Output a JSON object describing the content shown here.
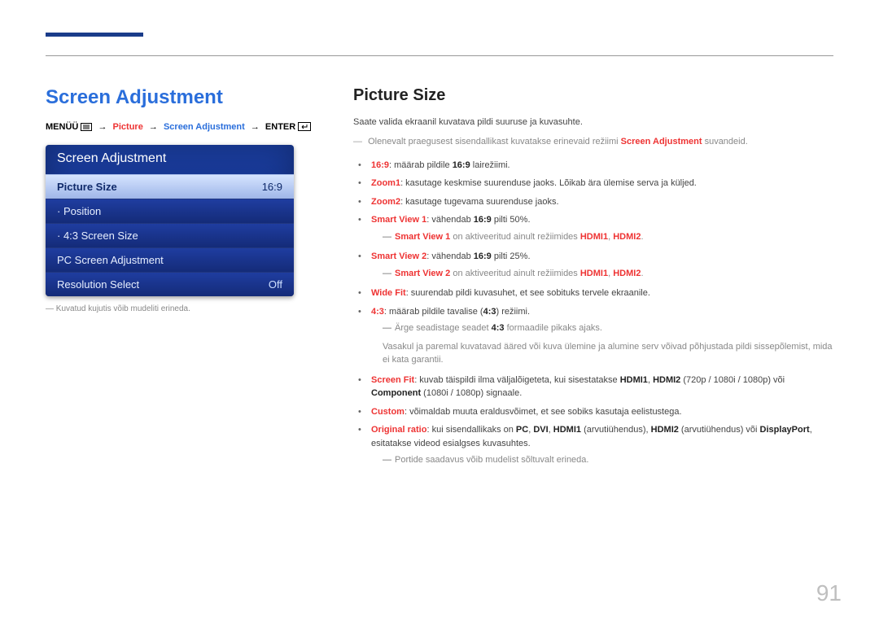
{
  "page_number": "91",
  "left": {
    "heading": "Screen Adjustment",
    "breadcrumb": {
      "menu": "MENÜÜ",
      "picture": "Picture",
      "screen_adj": "Screen Adjustment",
      "enter": "ENTER"
    },
    "osd": {
      "title": "Screen Adjustment",
      "rows": [
        {
          "label": "Picture Size",
          "value": "16:9",
          "selected": true
        },
        {
          "label": "· Position",
          "value": ""
        },
        {
          "label": "· 4:3 Screen Size",
          "value": ""
        },
        {
          "label": "PC Screen Adjustment",
          "value": ""
        },
        {
          "label": "Resolution Select",
          "value": "Off"
        }
      ]
    },
    "note": "Kuvatud kujutis võib mudeliti erineda."
  },
  "right": {
    "heading": "Picture Size",
    "intro": "Saate valida ekraanil kuvatava pildi suuruse ja kuvasuhte.",
    "global_note_pre": "Olenevalt praegusest sisendallikast kuvatakse erinevaid režiimi ",
    "global_note_hl": "Screen Adjustment",
    "global_note_post": " suvandeid.",
    "items": {
      "i0": {
        "hl": "16:9",
        "rest": ": määrab pildile ",
        "b": "16:9",
        "tail": " lairežiimi."
      },
      "i1": {
        "hl": "Zoom1",
        "rest": ": kasutage keskmise suurenduse jaoks. Lõikab ära ülemise serva ja küljed."
      },
      "i2": {
        "hl": "Zoom2",
        "rest": ": kasutage tugevama suurenduse jaoks."
      },
      "i3": {
        "hl": "Smart View 1",
        "rest2": ": vähendab ",
        "b": "16:9",
        "tail": " pilti 50%."
      },
      "i3note": {
        "pre": "Smart View 1",
        "mid": " on aktiveeritud ainult režiimides ",
        "b1": "HDMI1",
        "b2": "HDMI2",
        "post": "."
      },
      "i4": {
        "hl": "Smart View 2",
        "rest2": ": vähendab ",
        "b": "16:9",
        "tail": " pilti 25%."
      },
      "i4note": {
        "pre": "Smart View 2",
        "mid": " on aktiveeritud ainult režiimides ",
        "b1": "HDMI1",
        "b2": "HDMI2",
        "post": "."
      },
      "i5": {
        "hl": "Wide Fit",
        "rest": ": suurendab pildi kuvasuhet, et see sobituks tervele ekraanile."
      },
      "i6": {
        "hl": "4:3",
        "rest": ": määrab pildile tavalise (",
        "b": "4:3",
        "tail": ") režiimi."
      },
      "i6note1": "Ärge seadistage seadet 4:3 formaadile pikaks ajaks.",
      "i6note1_b": "4:3",
      "i6note2": "Vasakul ja paremal kuvatavad ääred või kuva ülemine ja alumine serv võivad põhjustada pildi sissepõlemist, mida ei kata garantii.",
      "i7": {
        "hl": "Screen Fit",
        "rest_a": ": kuvab täispildi ilma väljalõigeteta, kui sisestatakse ",
        "b1": "HDMI1",
        "b2": "HDMI2",
        "mid": " (720p / 1080i / 1080p) või ",
        "b3": "Component",
        "tail": " (1080i / 1080p) signaale."
      },
      "i8": {
        "hl": "Custom",
        "rest": ": võimaldab muuta eraldusvõimet, et see sobiks kasutaja eelistustega."
      },
      "i9": {
        "hl": "Original ratio",
        "rest_a": ": kui sisendallikaks on ",
        "b1": "PC",
        "b2": "DVI",
        "b3": "HDMI1",
        "mid1": " (arvutiühendus), ",
        "b4": "HDMI2",
        "mid2": " (arvutiühendus) või ",
        "b5": "DisplayPort",
        "tail": ", esitatakse videod esialgses kuvasuhtes."
      },
      "i9note": "Portide saadavus võib mudelist sõltuvalt erineda."
    }
  }
}
